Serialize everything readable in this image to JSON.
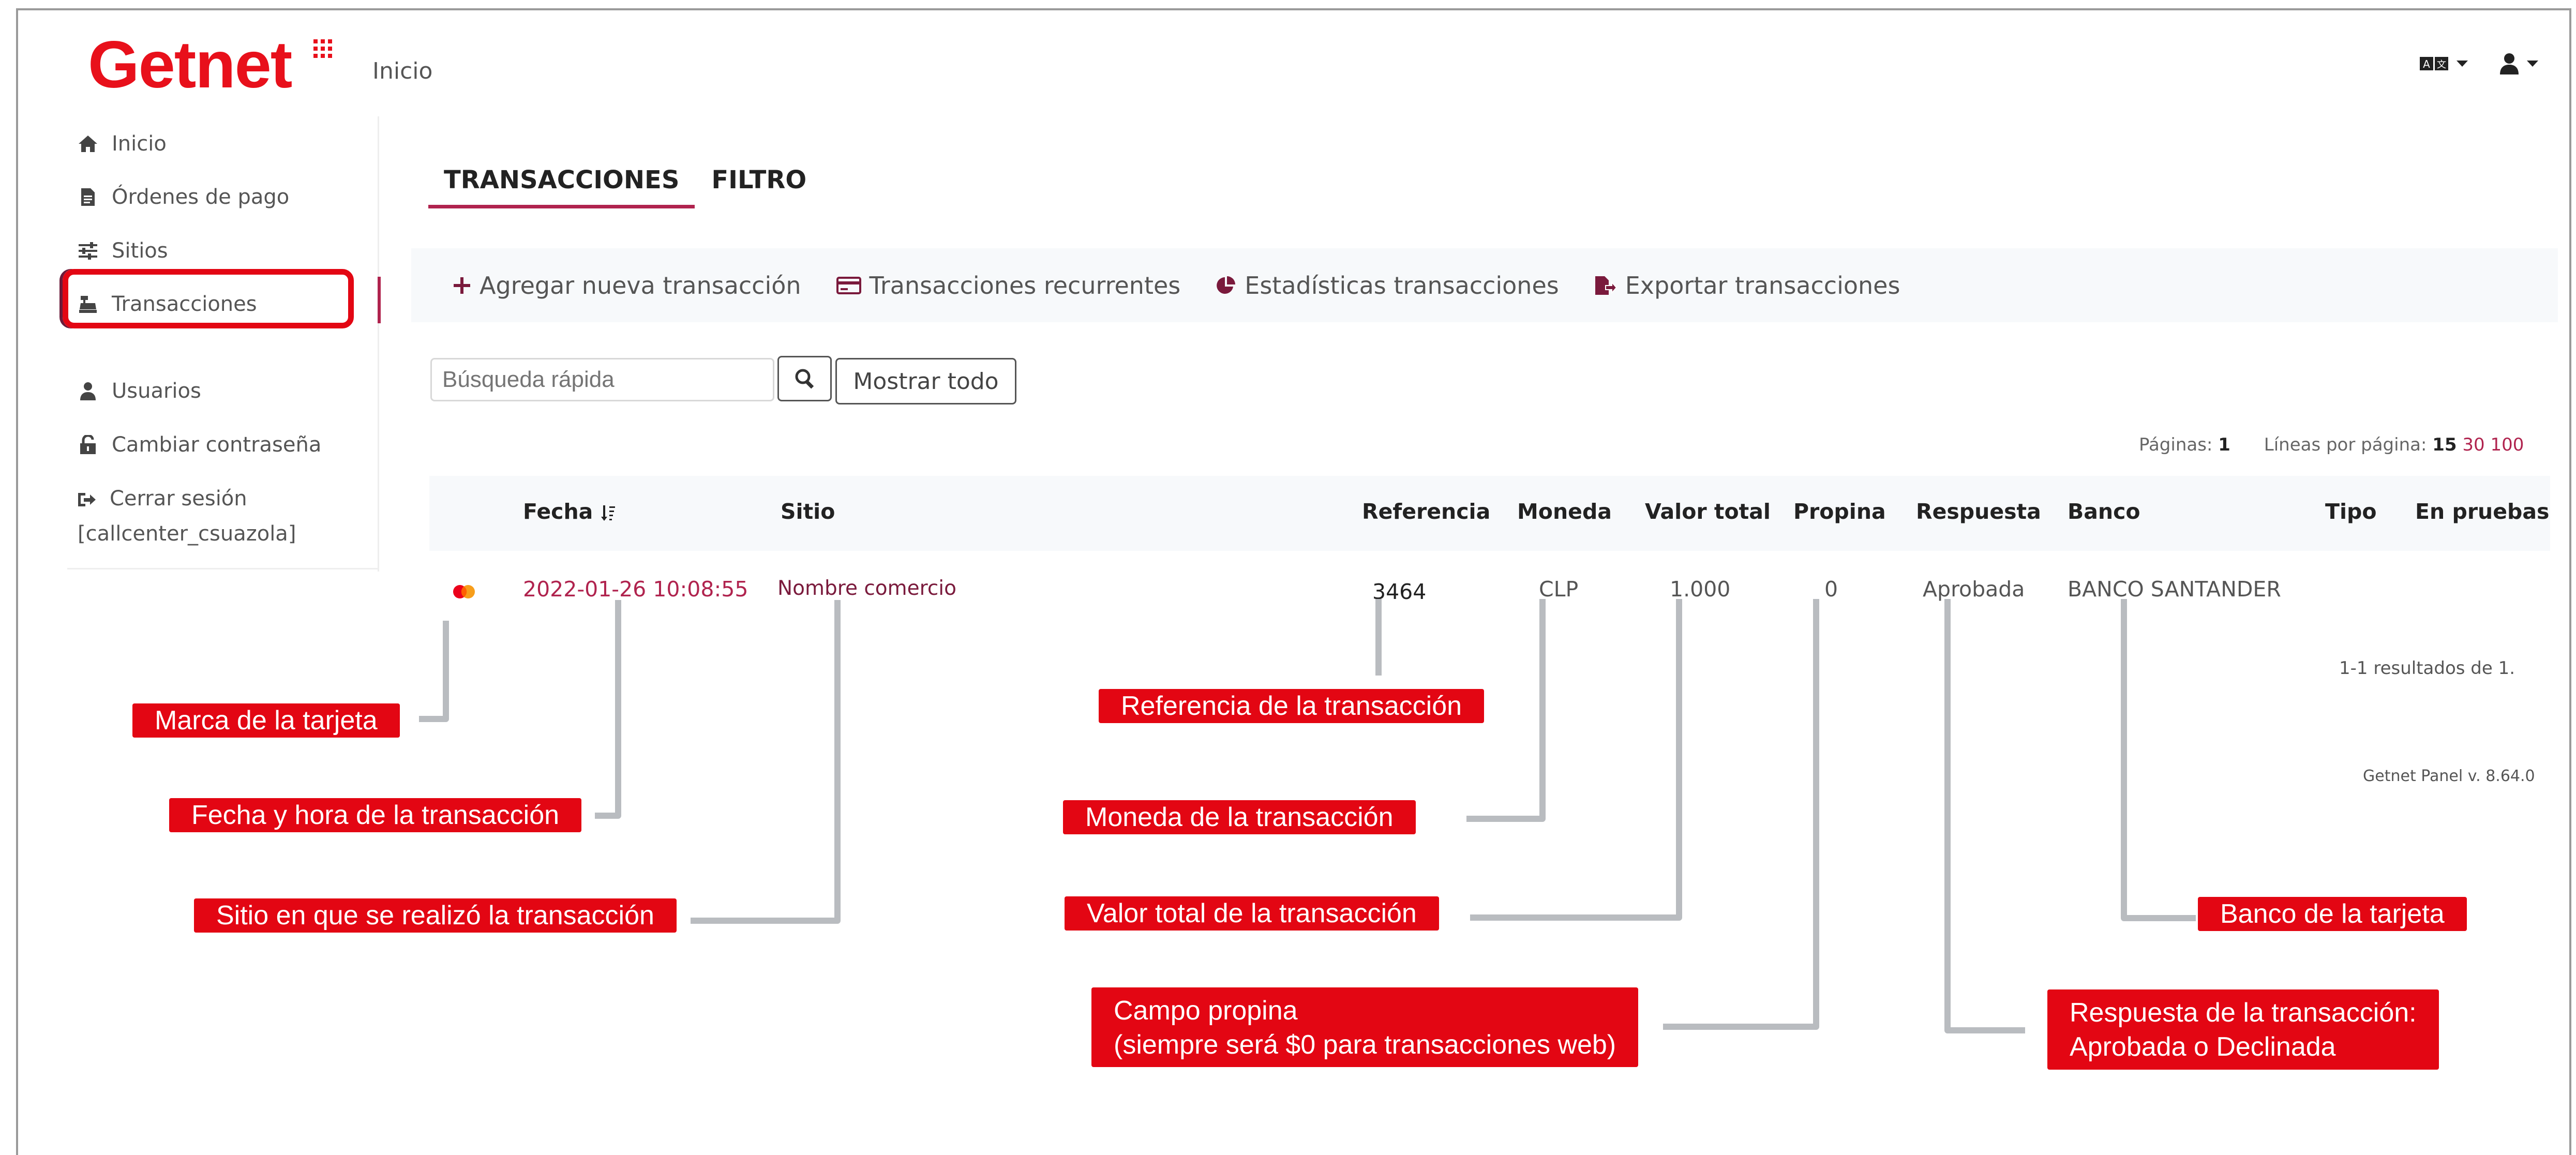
{
  "header": {
    "logo_text": "Getnet",
    "breadcrumb": "Inicio",
    "brand_color": "#e8101b",
    "icons": [
      "language-icon",
      "user-icon"
    ]
  },
  "sidebar": {
    "items": [
      {
        "label": "Inicio",
        "icon": "home-icon"
      },
      {
        "label": "Órdenes de pago",
        "icon": "document-icon"
      },
      {
        "label": "Sitios",
        "icon": "sliders-icon"
      },
      {
        "label": "Transacciones",
        "icon": "cash-register-icon",
        "active": true
      },
      {
        "label": "Usuarios",
        "icon": "user-icon"
      },
      {
        "label": "Cambiar contraseña",
        "icon": "unlock-icon"
      }
    ],
    "logout_label": "Cerrar sesión",
    "logout_user": "[callcenter_csuazola]"
  },
  "main": {
    "tabs": [
      {
        "label": "TRANSACCIONES",
        "active": true
      },
      {
        "label": "FILTRO",
        "active": false
      }
    ],
    "toolbar": [
      {
        "label": "Agregar nueva transacción",
        "icon": "plus-icon"
      },
      {
        "label": "Transacciones recurrentes",
        "icon": "credit-card-icon"
      },
      {
        "label": "Estadísticas transacciones",
        "icon": "pie-chart-icon"
      },
      {
        "label": "Exportar transacciones",
        "icon": "export-file-icon"
      }
    ],
    "search": {
      "placeholder": "Búsqueda rápida",
      "button_icon": "search-icon"
    },
    "show_all_label": "Mostrar todo",
    "pagination": {
      "pages_label": "Páginas:",
      "pages_value": "1",
      "lines_label": "Líneas por página:",
      "lines_current": "15",
      "lines_options": [
        "30",
        "100"
      ]
    },
    "table": {
      "columns": [
        "Fecha",
        "Sitio",
        "Referencia",
        "Moneda",
        "Valor total",
        "Propina",
        "Respuesta",
        "Banco",
        "Tipo",
        "En pruebas"
      ],
      "sort_icon": "sort-icon",
      "rows": [
        {
          "card_brand": "mastercard-icon",
          "fecha": "2022-01-26 10:08:55",
          "sitio": "Nombre comercio",
          "referencia": "3464",
          "moneda": "CLP",
          "valor_total": "1.000",
          "propina": "0",
          "respuesta": "Aprobada",
          "banco": "BANCO SANTANDER",
          "tipo": "",
          "en_pruebas": ""
        }
      ]
    },
    "results_text": "1-1 resultados de 1.",
    "version_text": "Getnet Panel v. 8.64.0"
  },
  "annotations": {
    "card_brand": "Marca de la tarjeta",
    "fecha": "Fecha y hora de la transacción",
    "sitio": "Sitio en que se realizó la transacción",
    "referencia": "Referencia de la transacción",
    "moneda": "Moneda de la transacción",
    "valor_total": "Valor total de la transacción",
    "propina_line1": "Campo propina",
    "propina_line2": "(siempre será $0 para transacciones web)",
    "banco": "Banco de la tarjeta",
    "respuesta_line1": "Respuesta de la transacción:",
    "respuesta_line2": "Aprobada o Declinada",
    "color": "#e30613",
    "leader_color": "#b9bcc0"
  }
}
